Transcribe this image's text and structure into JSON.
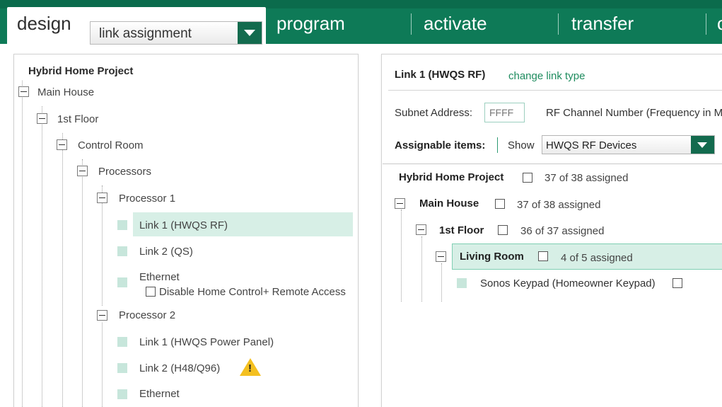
{
  "nav": {
    "active_tab": "design",
    "view_select": "link assignment",
    "tabs": [
      "program",
      "activate",
      "transfer"
    ],
    "overflow_tab": "c"
  },
  "left_tree": {
    "root": "Hybrid Home Project",
    "main_house": "Main House",
    "floor": "1st Floor",
    "room": "Control Room",
    "processors": "Processors",
    "processor1": {
      "label": "Processor 1",
      "link1": "Link 1 (HWQS RF)",
      "link2": "Link 2 (QS)",
      "ethernet": "Ethernet",
      "disable_remote": "Disable Home Control+ Remote Access"
    },
    "processor2": {
      "label": "Processor 2",
      "link1": "Link 1 (HWQS Power Panel)",
      "link2": "Link 2 (H48/Q96)",
      "link2_warning": "!",
      "ethernet": "Ethernet"
    }
  },
  "right_panel": {
    "link_title": "Link 1 (HWQS RF)",
    "change_link": "change link type",
    "subnet_label": "Subnet Address:",
    "subnet_value": "FFFF",
    "rf_channel_label": "RF Channel Number (Frequency in M",
    "assignable_label": "Assignable items:",
    "show_label": "Show",
    "show_value": "HWQS RF Devices",
    "tree": {
      "project": {
        "label": "Hybrid Home Project",
        "count": "37 of 38 assigned"
      },
      "main_house": {
        "label": "Main House",
        "count": "37 of 38 assigned"
      },
      "floor": {
        "label": "1st Floor",
        "count": "36 of 37 assigned"
      },
      "room": {
        "label": "Living Room",
        "count": "4 of 5 assigned"
      },
      "device": {
        "label": "Sonos Keypad (Homeowner Keypad)"
      }
    }
  },
  "colors": {
    "brand_green": "#0e7a57",
    "highlight": "#d7efe6",
    "link_green": "#1f8c5f",
    "warning_yellow": "#f4c020"
  }
}
